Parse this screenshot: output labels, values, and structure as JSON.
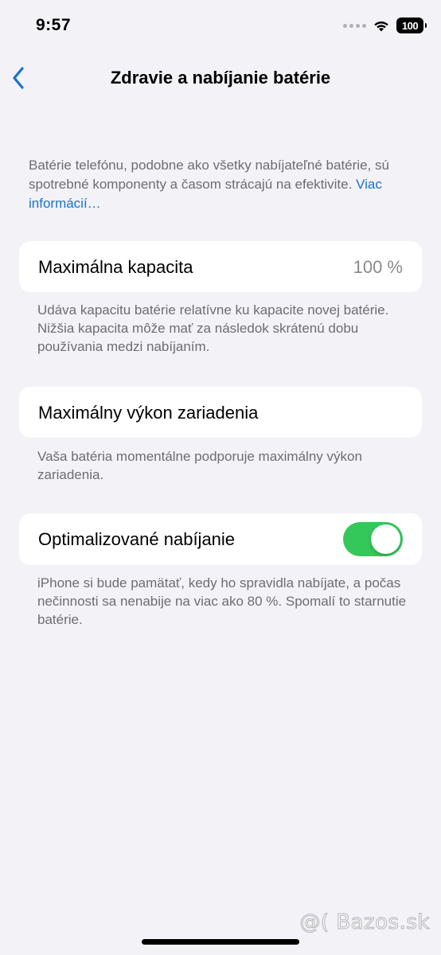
{
  "status_bar": {
    "time": "9:57",
    "battery_level": "100",
    "icons": [
      "signal-dots-icon",
      "wifi-icon",
      "battery-icon"
    ]
  },
  "nav": {
    "title": "Zdravie a nabíjanie batérie",
    "back_icon": "chevron-left-icon"
  },
  "intro": {
    "text": "Batérie telefónu, podobne ako všetky nabíjateľné batérie, sú spotrebné komponenty a časom strácajú na efektivite. ",
    "link_label": "Viac informácií…"
  },
  "maximum_capacity": {
    "label": "Maximálna kapacita",
    "value": "100 %",
    "footnote": "Udáva kapacitu batérie relatívne ku kapacite novej batérie. Nižšia kapacita môže mať za následok skrátenú dobu používania medzi nabíjaním."
  },
  "peak_performance": {
    "label": "Maximálny výkon zariadenia",
    "footnote": "Vaša batéria momentálne podporuje maximálny výkon zariadenia."
  },
  "optimized_charging": {
    "label": "Optimalizované nabíjanie",
    "enabled": true,
    "footnote": "iPhone si bude pamätať, kedy ho spravidla nabíjate, a počas nečinnosti sa nenabije na viac ako 80 %. Spomalí to starnutie batérie."
  },
  "watermark": "@( Bazos.sk",
  "colors": {
    "background": "#f2f2f7",
    "accent": "#1a73c9",
    "toggle_on": "#34c759",
    "secondary_text": "#6d6d72"
  }
}
